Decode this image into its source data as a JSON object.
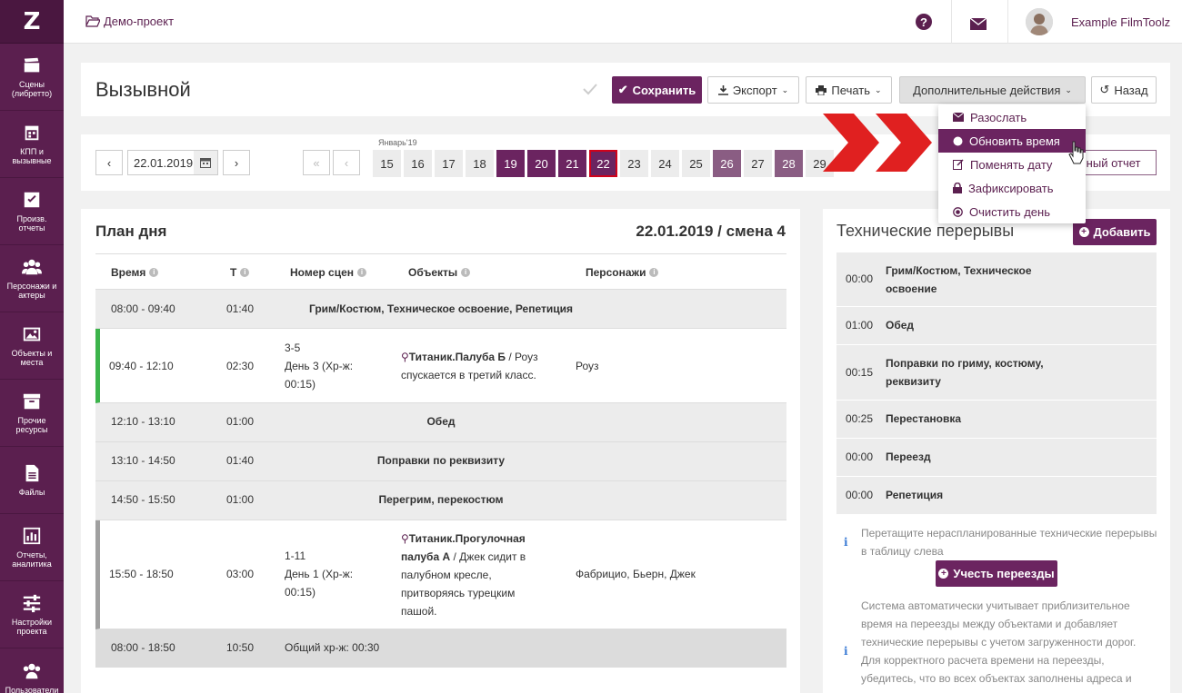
{
  "logo": "Z",
  "sidebar": [
    {
      "label": "Сцены (либретто)",
      "icon": "clapperboard-icon"
    },
    {
      "label": "КПП и вызывные",
      "icon": "calendar-icon"
    },
    {
      "label": "Произв. отчеты",
      "icon": "checkbox-icon"
    },
    {
      "label": "Персонажи и актеры",
      "icon": "people-icon"
    },
    {
      "label": "Объекты и места",
      "icon": "image-icon"
    },
    {
      "label": "Прочие ресурсы",
      "icon": "box-icon"
    },
    {
      "label": "Файлы",
      "icon": "file-icon"
    },
    {
      "label": "Отчеты, аналитика",
      "icon": "chart-icon"
    },
    {
      "label": "Настройки проекта",
      "icon": "sliders-icon"
    },
    {
      "label": "Пользователи и",
      "icon": "users-icon"
    }
  ],
  "breadcrumb": "Демо-проект",
  "user_name": "Example FilmToolz",
  "page_title": "Вызывной",
  "toolbar": {
    "save": "Сохранить",
    "export": "Экспорт",
    "print": "Печать",
    "more": "Дополнительные действия",
    "back": "Назад"
  },
  "menu": [
    {
      "label": "Разослать",
      "icon": "envelope-icon"
    },
    {
      "label": "Обновить время",
      "icon": "circle-icon"
    },
    {
      "label": "Поменять дату",
      "icon": "edit-icon"
    },
    {
      "label": "Зафиксировать",
      "icon": "lock-icon"
    },
    {
      "label": "Очистить день",
      "icon": "target-icon"
    }
  ],
  "date_nav": {
    "prev": "‹",
    "next": "›",
    "first": "«",
    "date_value": "22.01.2019",
    "month_label": "Январь'19",
    "days": [
      "15",
      "16",
      "17",
      "18",
      "19",
      "20",
      "21",
      "22",
      "23",
      "24",
      "25",
      "26",
      "27",
      "28",
      "29"
    ],
    "report_link": "нный отчет"
  },
  "plan": {
    "title": "План дня",
    "date_shift": "22.01.2019 / смена 4",
    "headers": [
      "Время",
      "Т",
      "Номер сцен",
      "Объекты",
      "Персонажи"
    ],
    "rows": [
      {
        "time": "08:00 - 09:40",
        "dur": "01:40",
        "label": "Грим/Костюм, Техническое освоение, Репетиция"
      },
      {
        "time": "09:40 - 12:10",
        "dur": "02:30",
        "scene": [
          "3-5",
          "День 3 (Хр-ж:",
          "00:15)"
        ],
        "object_bold": "Титаник.Палуба Б",
        "object_rest": " / Роуз спускается в третий класс.",
        "chars": "Роуз"
      },
      {
        "time": "12:10 - 13:10",
        "dur": "01:00",
        "label": "Обед"
      },
      {
        "time": "13:10 - 14:50",
        "dur": "01:40",
        "label": "Поправки по реквизиту"
      },
      {
        "time": "14:50 - 15:50",
        "dur": "01:00",
        "label": "Перегрим, перекостюм"
      },
      {
        "time": "15:50 - 18:50",
        "dur": "03:00",
        "scene": [
          "1-11",
          "День 1 (Хр-ж:",
          "00:15)"
        ],
        "object_bold": "Титаник.Прогулочная палуба А",
        "object_rest": " / Джек сидит в палубном кресле, притворяясь турецким пашой.",
        "chars": "Фабрицио, Бьерн, Джек"
      },
      {
        "time": "08:00 - 18:50",
        "dur": "10:50",
        "summary": "Общий хр-ж: 00:30"
      }
    ]
  },
  "tech": {
    "title": "Технические перерывы",
    "add": "Добавить",
    "rows": [
      {
        "t": "00:00",
        "n": "Грим/Костюм, Техническое освоение"
      },
      {
        "t": "01:00",
        "n": "Обед"
      },
      {
        "t": "00:15",
        "n": "Поправки по гриму, костюму, реквизиту"
      },
      {
        "t": "00:25",
        "n": "Перестановка"
      },
      {
        "t": "00:00",
        "n": "Переезд"
      },
      {
        "t": "00:00",
        "n": "Репетиция"
      }
    ],
    "hint": "Перетащите нераспланированные технические перерывы в таблицу слева",
    "account_btn": "Учесть переезды",
    "note": "Система автоматически учитывает приблизительное время на переезды между объектами и добавляет технические перерывы с учетом загруженности дорог. Для корректного расчета времени на переезды, убедитесь, что во всех объектах заполнены адреса и"
  },
  "colors": {
    "brand": "#6b2460",
    "sidebar": "#5b1f4f",
    "accent_red": "#e02020",
    "green": "#3cb44b"
  }
}
